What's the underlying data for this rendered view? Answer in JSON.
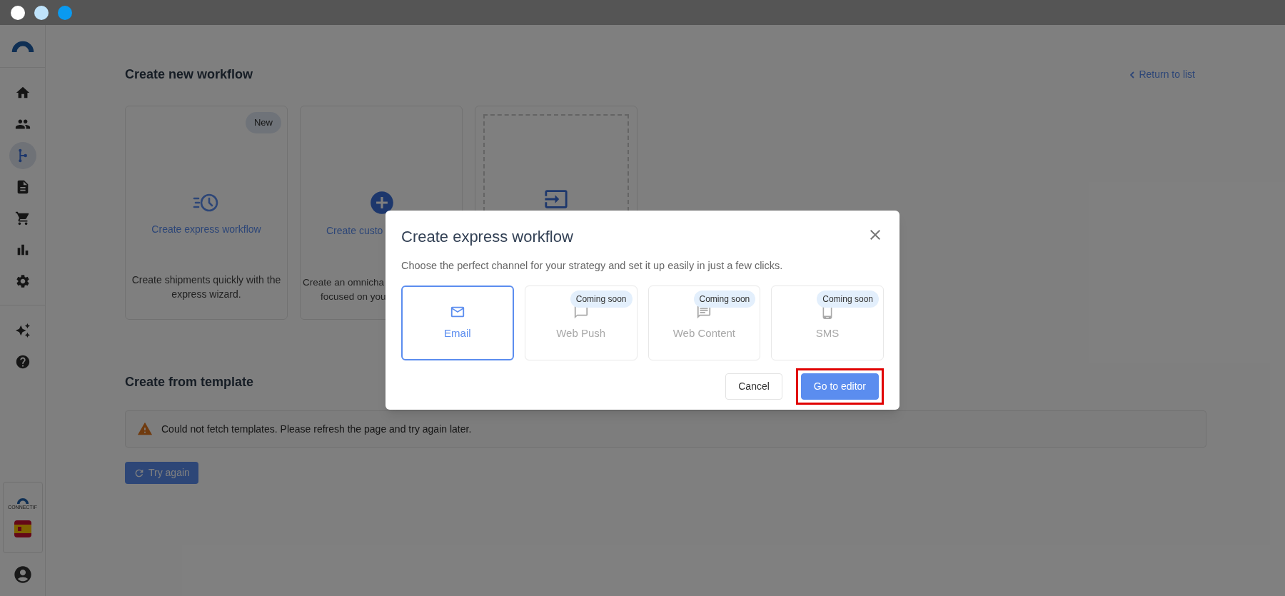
{
  "window_dots": [
    {
      "color": "#ffffff"
    },
    {
      "color": "#bfe3fb"
    },
    {
      "color": "#0a9af0"
    }
  ],
  "sidebar": {
    "items": [
      {
        "selected": false
      },
      {
        "selected": false
      },
      {
        "selected": true
      },
      {
        "selected": false
      },
      {
        "selected": false
      },
      {
        "selected": false
      },
      {
        "selected": false
      }
    ],
    "extra_items": [
      {
        "selected": false
      },
      {
        "selected": false
      }
    ],
    "brand": "CONNECTIF"
  },
  "page": {
    "title": "Create new workflow",
    "return_link": "Return to list",
    "cards": [
      {
        "kind": "express",
        "title": "Create express workflow",
        "badge": "New",
        "description": "Create shipments quickly with the express wizard."
      },
      {
        "kind": "custom",
        "title": "Create custo",
        "description_lines": [
          "Create an omnicha",
          "focused on you"
        ]
      },
      {
        "kind": "import"
      }
    ],
    "template_heading": "Create from template",
    "error_message": "Could not fetch templates. Please refresh the page and try again later.",
    "retry_button": "Try again"
  },
  "dialog": {
    "title": "Create express workflow",
    "subtitle": "Choose the perfect channel for your strategy and set it up easily in just a few clicks.",
    "channels": [
      {
        "kind": "email",
        "label": "Email",
        "selected": true,
        "disabled": false
      },
      {
        "kind": "push",
        "label": "Web Push",
        "selected": false,
        "disabled": true,
        "badge": "Coming soon"
      },
      {
        "kind": "content",
        "label": "Web Content",
        "selected": false,
        "disabled": true,
        "badge": "Coming soon"
      },
      {
        "kind": "sms",
        "label": "SMS",
        "selected": false,
        "disabled": true,
        "badge": "Coming soon"
      }
    ],
    "buttons": [
      {
        "kind": "secondary",
        "label": "Cancel",
        "highlighted": false
      },
      {
        "kind": "primary",
        "label": "Go to editor",
        "highlighted": true
      }
    ]
  }
}
